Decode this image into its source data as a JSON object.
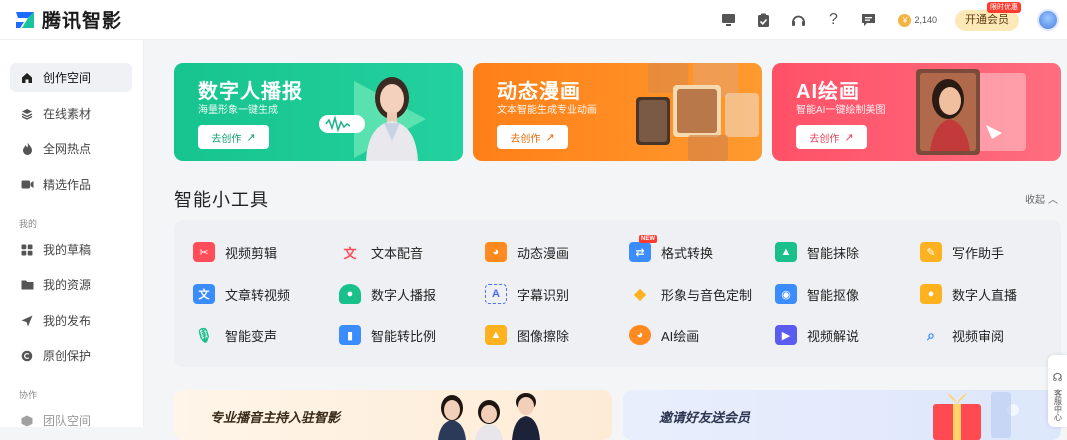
{
  "header": {
    "brand": "腾讯智影",
    "coins": "2,140",
    "vip_label": "开通会员",
    "vip_badge": "限时优惠"
  },
  "sidebar": {
    "items": [
      {
        "label": "创作空间",
        "icon": "home-icon"
      },
      {
        "label": "在线素材",
        "icon": "layers-icon"
      },
      {
        "label": "全网热点",
        "icon": "flame-icon"
      },
      {
        "label": "精选作品",
        "icon": "video-icon"
      }
    ],
    "group_mine": "我的",
    "mine_items": [
      {
        "label": "我的草稿",
        "icon": "grid-icon"
      },
      {
        "label": "我的资源",
        "icon": "folder-icon"
      },
      {
        "label": "我的发布",
        "icon": "send-icon"
      },
      {
        "label": "原创保护",
        "icon": "copyright-icon"
      }
    ],
    "group_collab": "协作",
    "collab_items": [
      {
        "label": "团队空间",
        "icon": "cube-icon"
      }
    ]
  },
  "banners": [
    {
      "title": "数字人播报",
      "subtitle": "海量形象一键生成",
      "button": "去创作"
    },
    {
      "title": "动态漫画",
      "subtitle": "文本智能生成专业动画",
      "button": "去创作"
    },
    {
      "title": "AI绘画",
      "subtitle": "智能AI一键绘制美图",
      "button": "去创作"
    }
  ],
  "tools_section": {
    "title": "智能小工具",
    "collapse_label": "收起",
    "rows": [
      [
        "视频剪辑",
        "文本配音",
        "动态漫画",
        "格式转换",
        "智能抹除",
        "写作助手"
      ],
      [
        "文章转视频",
        "数字人播报",
        "字幕识别",
        "形象与音色定制",
        "智能抠像",
        "数字人直播"
      ],
      [
        "智能变声",
        "智能转比例",
        "图像擦除",
        "AI绘画",
        "视频解说",
        "视频审阅"
      ]
    ],
    "new_tag": "NEW"
  },
  "cards": [
    {
      "title": "专业播音主持入驻智影"
    },
    {
      "title": "邀请好友送会员"
    }
  ],
  "float_tab": "客服中心",
  "colors": {
    "green": "#17c48f",
    "orange": "#ff7f18",
    "red": "#ff5168"
  }
}
